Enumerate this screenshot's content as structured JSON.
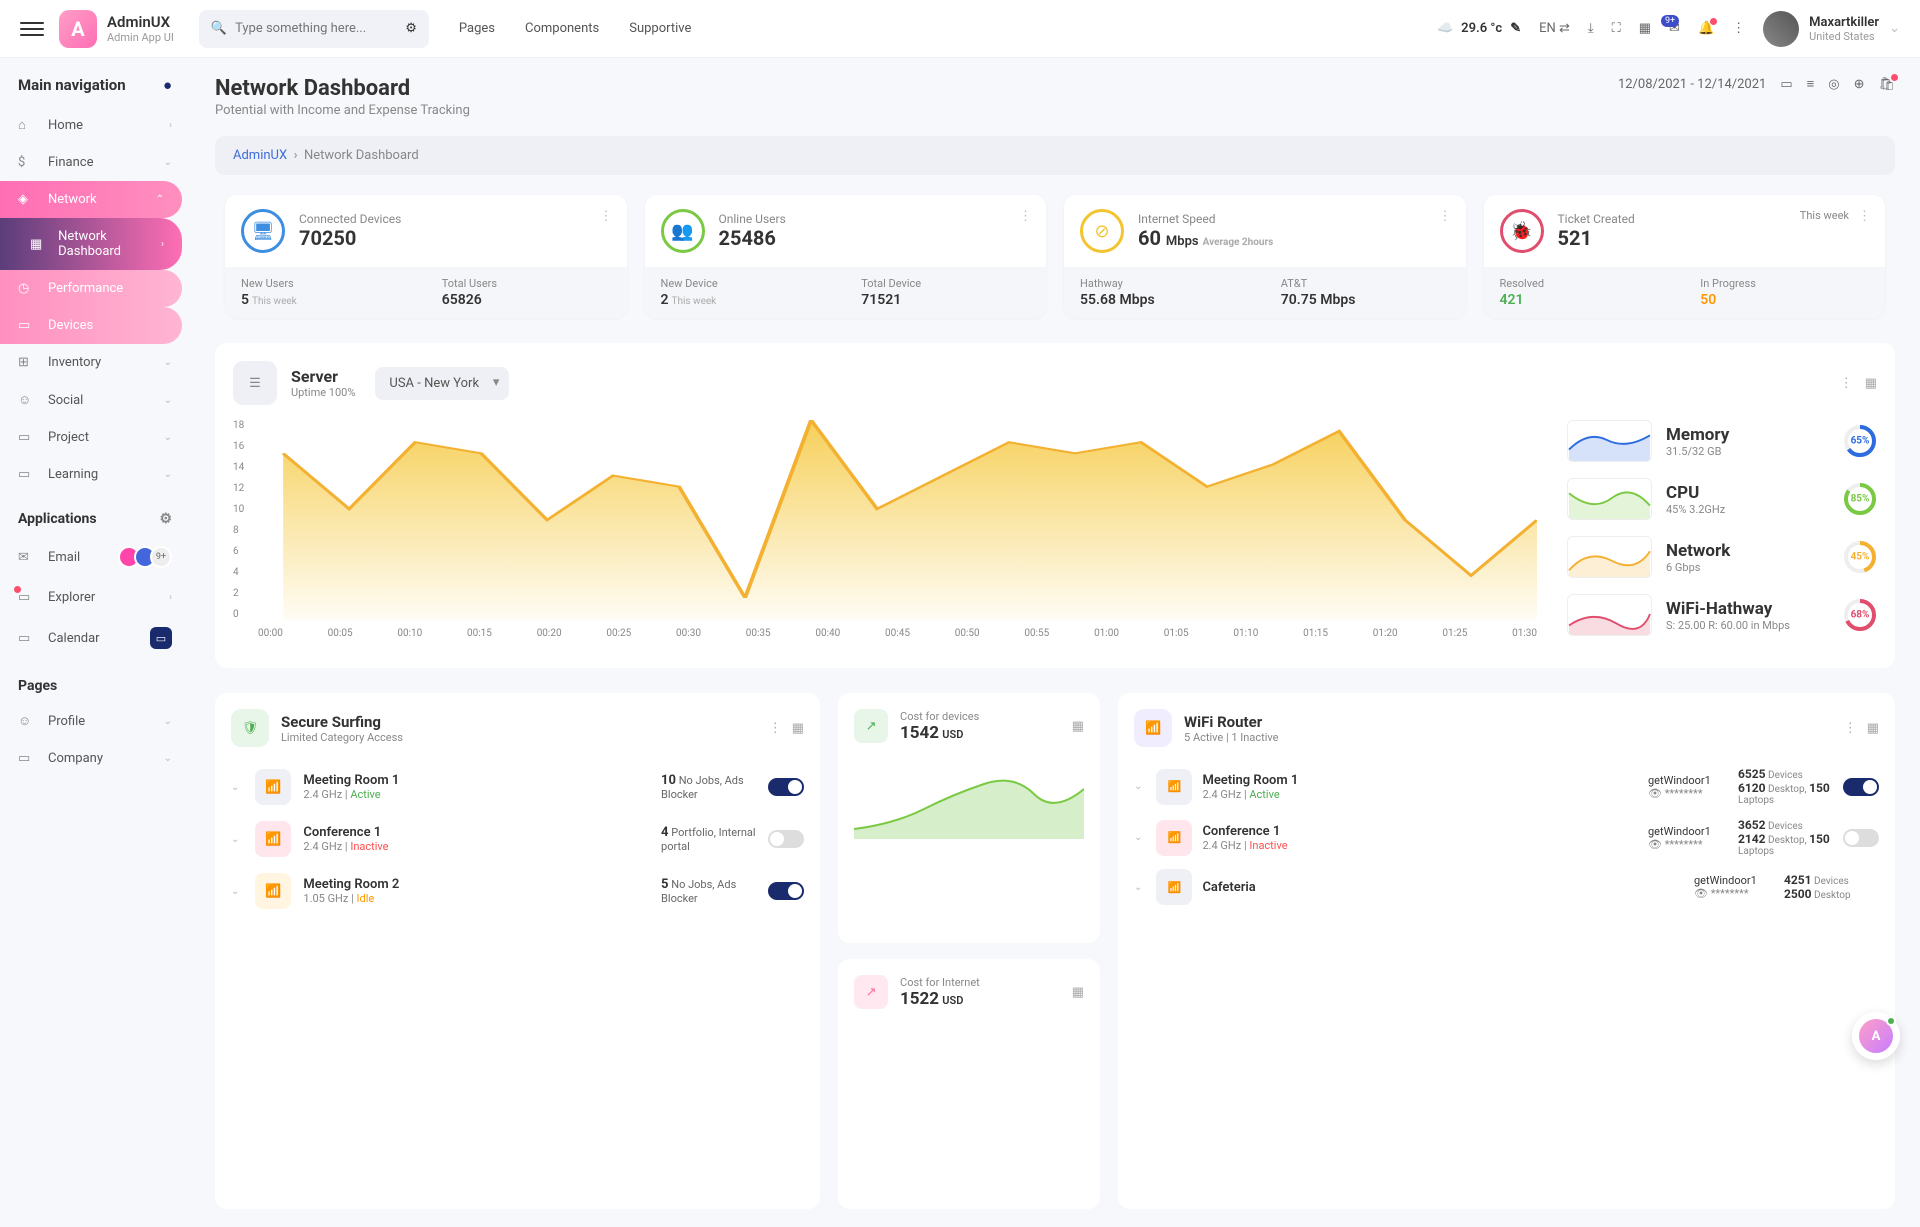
{
  "brand": {
    "title": "AdminUX",
    "sub": "Admin App UI",
    "logo": "A"
  },
  "search": {
    "placeholder": "Type something here..."
  },
  "topnav": [
    "Pages",
    "Components",
    "Supportive"
  ],
  "weather": {
    "temp": "29.6 °c"
  },
  "lang": "EN",
  "msg_badge": "9+",
  "user": {
    "name": "Maxartkiller",
    "loc": "United States"
  },
  "sidebar": {
    "title": "Main navigation",
    "items": [
      "Home",
      "Finance",
      "Network",
      "Inventory",
      "Social",
      "Project",
      "Learning"
    ],
    "network_sub": [
      "Network Dashboard",
      "Performance",
      "Devices"
    ],
    "apps_title": "Applications",
    "apps": [
      "Email",
      "Explorer",
      "Calendar"
    ],
    "avatars_more": "9+",
    "pages_title": "Pages",
    "pages": [
      "Profile",
      "Company"
    ]
  },
  "page": {
    "title": "Network Dashboard",
    "sub": "Potential with Income and Expense Tracking",
    "daterange": "12/08/2021 - 12/14/2021"
  },
  "breadcrumb": {
    "root": "AdminUX",
    "current": "Network Dashboard"
  },
  "stats": [
    {
      "label": "Connected Devices",
      "value": "70250",
      "cells": [
        {
          "l": "New Users",
          "v": "5",
          "n": "This week"
        },
        {
          "l": "Total Users",
          "v": "65826"
        }
      ]
    },
    {
      "label": "Online Users",
      "value": "25486",
      "cells": [
        {
          "l": "New Device",
          "v": "2",
          "n": "This week"
        },
        {
          "l": "Total Device",
          "v": "71521"
        }
      ]
    },
    {
      "label": "Internet Speed",
      "value": "60",
      "unit": "Mbps",
      "note": "Average 2hours",
      "cells": [
        {
          "l": "Hathway",
          "v": "55.68 Mbps"
        },
        {
          "l": "AT&T",
          "v": "70.75 Mbps"
        }
      ]
    },
    {
      "label": "Ticket Created",
      "value": "521",
      "pill": "This week",
      "cells": [
        {
          "l": "Resolved",
          "v": "421",
          "cls": "green"
        },
        {
          "l": "In Progress",
          "v": "50",
          "cls": "orange"
        }
      ]
    }
  ],
  "server": {
    "title": "Server",
    "uptime": "Uptime 100%",
    "location": "USA - New York"
  },
  "chart_data": {
    "type": "area",
    "x": [
      "00:00",
      "00:05",
      "00:10",
      "00:15",
      "00:20",
      "00:25",
      "00:30",
      "00:35",
      "00:40",
      "00:45",
      "00:50",
      "00:55",
      "01:00",
      "01:05",
      "01:10",
      "01:15",
      "01:20",
      "01:25",
      "01:30"
    ],
    "values": [
      15,
      10,
      16,
      15,
      9,
      13,
      12,
      2,
      18,
      10,
      13,
      16,
      15,
      16,
      12,
      14,
      17,
      9,
      4,
      9
    ],
    "ylim": [
      0,
      18
    ],
    "yticks": [
      0,
      2,
      4,
      6,
      8,
      10,
      12,
      14,
      16,
      18
    ]
  },
  "metrics": [
    {
      "title": "Memory",
      "sub": "31.5/32 GB",
      "pct": "65",
      "color": "#2d6cdf"
    },
    {
      "title": "CPU",
      "sub": "45% 3.2GHz",
      "pct": "85",
      "color": "#7ac943"
    },
    {
      "title": "Network",
      "sub": "6 Gbps",
      "pct": "45",
      "color": "#f4b030"
    },
    {
      "title": "WiFi-Hathway",
      "sub": "S: 25.00 R: 60.00 in Mbps",
      "pct": "68",
      "color": "#e04d6d"
    }
  ],
  "secure": {
    "title": "Secure Surfing",
    "sub": "Limited Category Access",
    "rooms": [
      {
        "name": "Meeting Room 1",
        "freq": "2.4 GHz",
        "status": "Active",
        "scls": "room-status-a",
        "cnt": "10",
        "note": "No Jobs, Ads Blocker",
        "on": true,
        "icls": "ri-gray"
      },
      {
        "name": "Conference 1",
        "freq": "2.4 GHz",
        "status": "Inactive",
        "scls": "room-status-i",
        "cnt": "4",
        "note": "Portfolio, Internal portal",
        "on": false,
        "icls": "ri-pink"
      },
      {
        "name": "Meeting Room 2",
        "freq": "1.05 GHz",
        "status": "Idle",
        "scls": "room-status-idle",
        "cnt": "5",
        "note": "No Jobs, Ads Blocker",
        "on": true,
        "icls": "ri-yellow"
      }
    ]
  },
  "costs": [
    {
      "label": "Cost for devices",
      "val": "1542",
      "unit": "USD",
      "icls": "cci-green"
    },
    {
      "label": "Cost for Internet",
      "val": "1522",
      "unit": "USD",
      "icls": "cci-pink"
    }
  ],
  "wifi": {
    "title": "WiFi Router",
    "sub": "5 Active  |  1 Inactive",
    "rows": [
      {
        "name": "Meeting Room 1",
        "freq": "2.4 GHz",
        "status": "Active",
        "scls": "room-status-a",
        "ssid": "getWindoor1",
        "dev": "6525",
        "desk": "6120",
        "lap": "150",
        "on": true,
        "icls": "ri-gray"
      },
      {
        "name": "Conference 1",
        "freq": "2.4 GHz",
        "status": "Inactive",
        "scls": "room-status-i",
        "ssid": "getWindoor1",
        "dev": "3652",
        "desk": "2142",
        "lap": "150",
        "on": false,
        "icls": "ri-pink"
      },
      {
        "name": "Cafeteria",
        "freq": "",
        "status": "",
        "ssid": "getWindoor1",
        "dev": "4251",
        "desk": "2500",
        "lap": "",
        "icls": "ri-gray"
      }
    ]
  }
}
